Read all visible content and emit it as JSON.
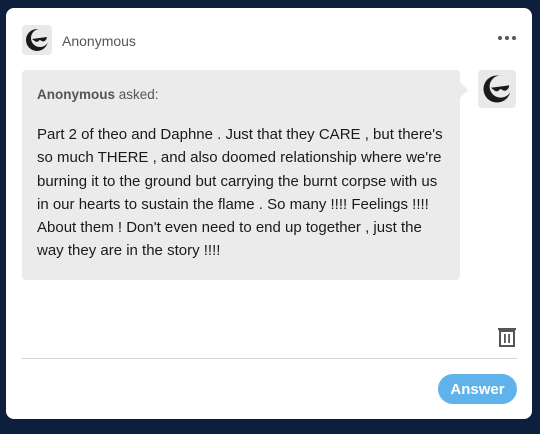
{
  "header": {
    "asker_name": "Anonymous",
    "avatar_icon": "anonymous-sunglasses-icon",
    "more_icon": "more-dots-icon"
  },
  "question": {
    "asker": "Anonymous",
    "asked_label": "asked:",
    "text": "Part 2 of theo and Daphne . Just that they CARE , but there's so much THERE , and also doomed relationship where we're burning it to the ground but carrying the burnt corpse with us in our hearts to sustain the flame . So many !!!! Feelings !!!! About them ! Don't even need to end up together , just the way they are in the story !!!!"
  },
  "actions": {
    "delete_icon": "trash-icon",
    "answer_label": "Answer"
  },
  "colors": {
    "page_background": "#0d1f3c",
    "bubble": "#ebebeb",
    "answer_button": "#5fb3ea"
  }
}
